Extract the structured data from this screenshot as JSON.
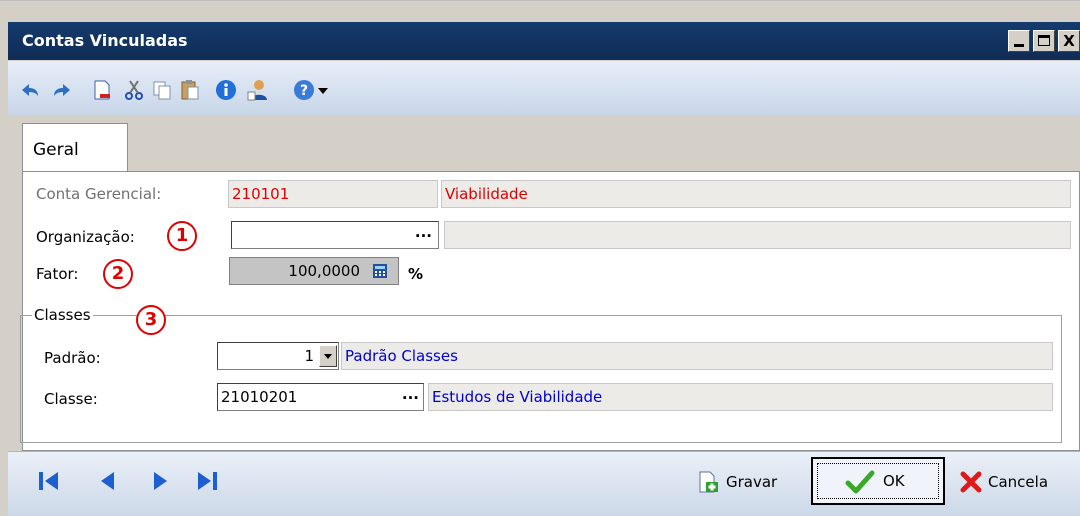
{
  "window": {
    "title": "Contas Vinculadas",
    "controls": [
      "_",
      "□",
      "X"
    ]
  },
  "toolbar": {
    "icons": [
      "undo-icon",
      "redo-icon",
      "new-document-icon",
      "cut-icon",
      "copy-icon",
      "paste-icon",
      "info-icon",
      "user-icon",
      "help-icon",
      "dropdown-arrow-icon"
    ]
  },
  "tabs": [
    {
      "label": "Geral"
    }
  ],
  "form": {
    "conta_gerencial": {
      "label": "Conta Gerencial:",
      "code": "210101",
      "name": "Viabilidade"
    },
    "organizacao": {
      "label": "Organização:",
      "ellipsis": "...",
      "value": "",
      "name": ""
    },
    "fator": {
      "label": "Fator:",
      "value": "100,0000",
      "unit": "%"
    },
    "classes": {
      "group_label": "Classes",
      "padrao": {
        "label": "Padrão:",
        "value": "1",
        "name": "Padrão Classes"
      },
      "classe": {
        "label": "Classe:",
        "value": "21010201",
        "ellipsis": "...",
        "name": "Estudos de Viabilidade"
      }
    }
  },
  "markers": [
    "1",
    "2",
    "3"
  ],
  "nav": [
    "first-record-icon",
    "previous-record-icon",
    "next-record-icon",
    "last-record-icon"
  ],
  "actions": {
    "gravar": "Gravar",
    "ok": "OK",
    "cancela": "Cancela"
  },
  "colors": {
    "titlebar": "#153b6e",
    "red_text": "#e00000",
    "blue_text": "#0000d0",
    "nav_icon": "#1d5fd0"
  }
}
